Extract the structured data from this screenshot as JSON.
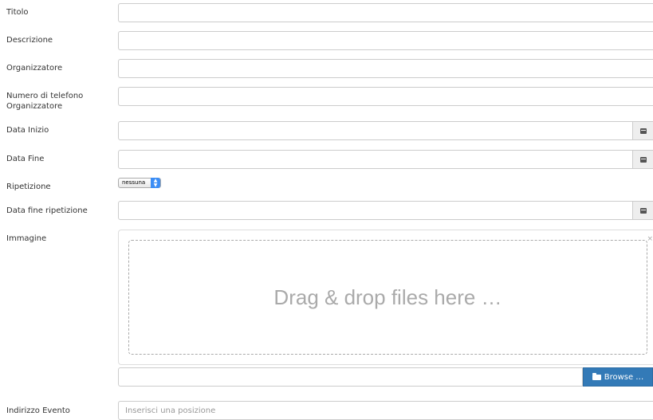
{
  "form": {
    "titolo": {
      "label": "Titolo",
      "value": ""
    },
    "descrizione": {
      "label": "Descrizione",
      "value": ""
    },
    "organizzatore": {
      "label": "Organizzatore",
      "value": ""
    },
    "telefono": {
      "label_line1": "Numero di telefono",
      "label_line2": "Organizzatore",
      "value": ""
    },
    "data_inizio": {
      "label": "Data Inizio",
      "value": "",
      "icon": "calendar-icon"
    },
    "data_fine": {
      "label": "Data Fine",
      "value": "",
      "icon": "calendar-icon"
    },
    "ripetizione": {
      "label": "Ripetizione",
      "selected": "nessuna"
    },
    "data_fine_ripetizione": {
      "label": "Data fine ripetizione",
      "value": "",
      "icon": "calendar-icon"
    },
    "immagine": {
      "label": "Immagine",
      "dropzone_text": "Drag & drop files here …",
      "close": "×",
      "browse_label": "Browse …",
      "browse_icon": "folder-open-icon"
    },
    "indirizzo": {
      "label": "Indirizzo Evento",
      "placeholder": "Inserisci una posizione"
    }
  },
  "colors": {
    "primary": "#337ab7",
    "select_accent": "#3b8df5"
  }
}
